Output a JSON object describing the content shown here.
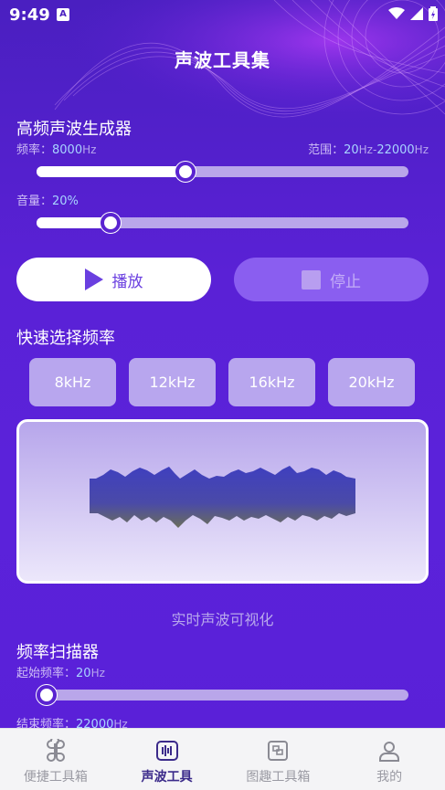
{
  "status_bar": {
    "time": "9:49",
    "notification_letter": "A"
  },
  "app_title": "声波工具集",
  "generator": {
    "title": "高频声波生成器",
    "frequency_label": "频率：",
    "frequency_value": "8000",
    "frequency_unit": "Hz",
    "range_label": "范围：",
    "range_min": "20",
    "range_sep": "Hz-",
    "range_max": "22000",
    "range_unit": "Hz",
    "frequency_slider_fraction": 0.4,
    "volume_label": "音量：",
    "volume_value": "20%",
    "volume_slider_fraction": 0.2
  },
  "controls": {
    "play_label": "播放",
    "stop_label": "停止"
  },
  "quick_select": {
    "title": "快速选择频率",
    "presets": [
      "8kHz",
      "12kHz",
      "16kHz",
      "20kHz"
    ]
  },
  "visualizer": {
    "caption": "实时声波可视化"
  },
  "scanner": {
    "title": "频率扫描器",
    "start_label": "起始频率：",
    "start_value": "20",
    "start_unit": "Hz",
    "start_slider_fraction": 0.0,
    "end_label": "结束频率：",
    "end_value": "22000",
    "end_unit": "Hz"
  },
  "bottom_nav": [
    {
      "label": "便捷工具箱",
      "icon": "command-icon",
      "active": false
    },
    {
      "label": "声波工具",
      "icon": "waveform-icon",
      "active": true
    },
    {
      "label": "图趣工具箱",
      "icon": "gallery-icon",
      "active": false
    },
    {
      "label": "我的",
      "icon": "person-icon",
      "active": false
    }
  ],
  "colors": {
    "accent": "#5a21d6",
    "active_nav": "#3b2a8a"
  }
}
